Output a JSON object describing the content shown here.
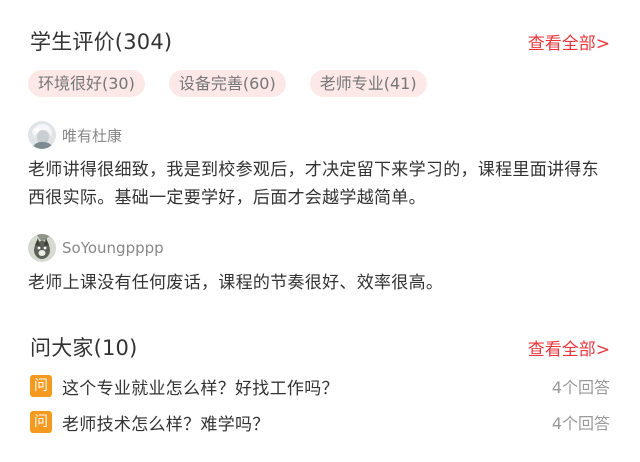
{
  "reviews_section": {
    "title": "学生评价(304)",
    "see_all": "查看全部>",
    "tags": [
      "环境很好(30)",
      "设备完善(60)",
      "老师专业(41)"
    ],
    "reviews": [
      {
        "username": "唯有杜康",
        "text": "老师讲得很细致，我是到校参观后，才决定留下来学习的，课程里面讲得东西很实际。基础一定要学好，后面才会越学越简单。"
      },
      {
        "username": "SoYoungpppp",
        "text": "老师上课没有任何废话，课程的节奏很好、效率很高。"
      }
    ]
  },
  "qa_section": {
    "title": "问大家(10)",
    "see_all": "查看全部>",
    "badge": "问",
    "questions": [
      {
        "text": "这个专业就业怎么样？好找工作吗？",
        "answers": "4个回答"
      },
      {
        "text": "老师技术怎么样？难学吗？",
        "answers": "4个回答"
      }
    ]
  },
  "colors": {
    "accent_red": "#e8383d",
    "tag_bg": "#fde8e8",
    "question_badge": "#f39a1f"
  }
}
